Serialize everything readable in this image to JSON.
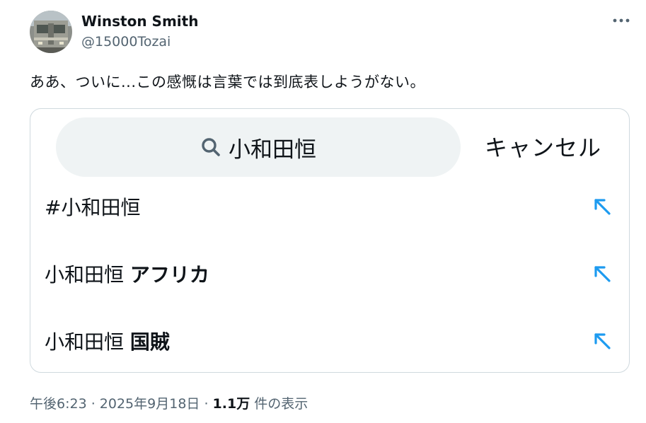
{
  "author": {
    "display_name": "Winston Smith",
    "handle": "@15000Tozai"
  },
  "tweet": {
    "text": "ああ、ついに...この感慨は言葉では到底表しようがない。"
  },
  "search_card": {
    "query": "小和田恒",
    "cancel_label": "キャンセル",
    "suggestions": [
      {
        "prefix": "#小和田恒",
        "bold": ""
      },
      {
        "prefix": "小和田恒 ",
        "bold": "アフリカ"
      },
      {
        "prefix": "小和田恒 ",
        "bold": "国賊"
      }
    ]
  },
  "footer": {
    "timestamp": "午後6:23 · 2025年9月18日 · ",
    "views_count": "1.1万",
    "views_label": " 件の表示"
  },
  "colors": {
    "accent": "#1d9bf0",
    "muted_text": "#536471",
    "search_bg": "#eff3f4",
    "border": "#cfd9de"
  },
  "icons": {
    "more": "more-horizontal-icon",
    "search": "search-icon",
    "suggestion_arrow": "arrow-up-left-icon"
  }
}
